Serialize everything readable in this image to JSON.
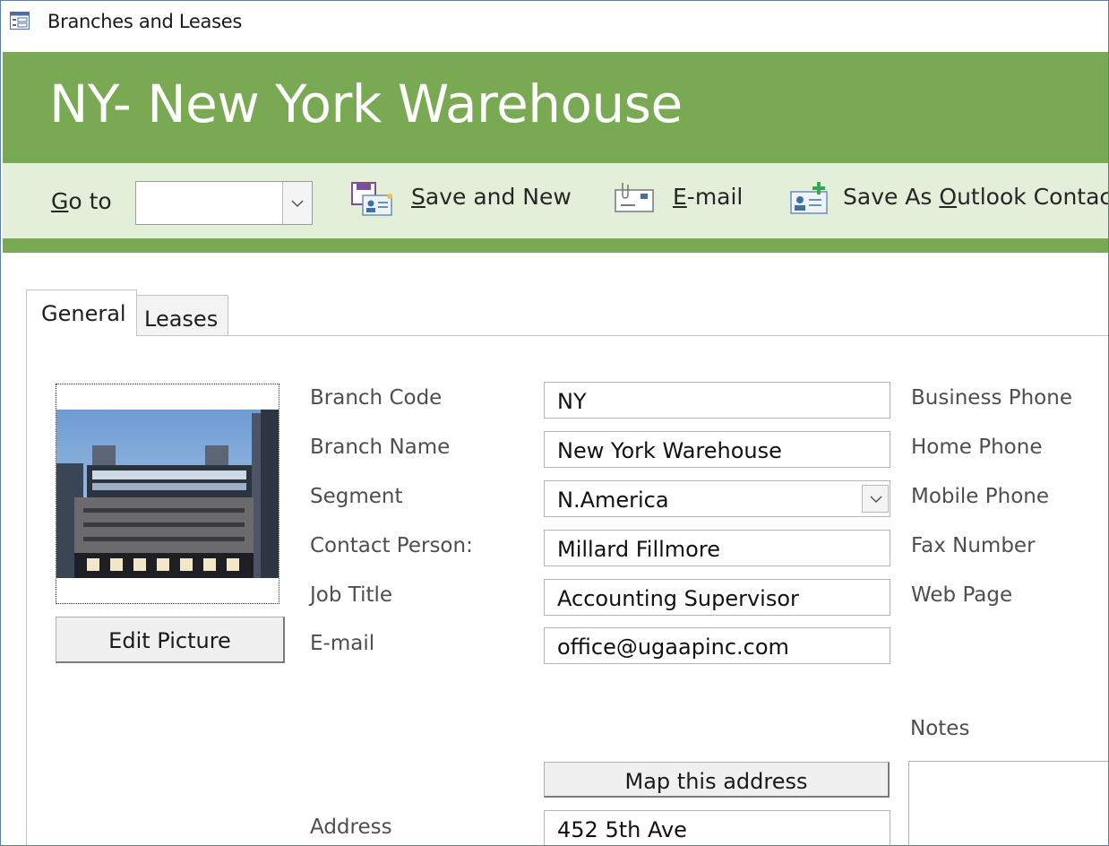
{
  "window": {
    "title": "Branches and Leases",
    "icon": "form-icon"
  },
  "header": {
    "title": "NY- New York Warehouse"
  },
  "toolbar": {
    "goto_label": "Go to",
    "goto_value": "",
    "save_new_label": "Save and New",
    "email_label": "E-mail",
    "outlook_label": "Save As Outlook Contact"
  },
  "tabs": [
    {
      "label": "General",
      "active": true
    },
    {
      "label": "Leases",
      "active": false
    }
  ],
  "picture": {
    "edit_label": "Edit Picture"
  },
  "fields": {
    "branch_code": {
      "label": "Branch Code",
      "value": "NY"
    },
    "branch_name": {
      "label": "Branch Name",
      "value": "New York Warehouse"
    },
    "segment": {
      "label": "Segment",
      "value": "N.America"
    },
    "contact_person": {
      "label": "Contact Person:",
      "value": "Millard Fillmore"
    },
    "job_title": {
      "label": "Job Title",
      "value": "Accounting Supervisor"
    },
    "email": {
      "label": "E-mail",
      "value": "office@ugaapinc.com"
    },
    "address": {
      "label": "Address",
      "value": "452 5th Ave"
    }
  },
  "phones": {
    "business": "Business Phone",
    "home": "Home Phone",
    "mobile": "Mobile Phone",
    "fax": "Fax Number",
    "web": "Web Page"
  },
  "map_button": "Map this address",
  "notes_label": "Notes",
  "colors": {
    "accent": "#7aa954",
    "toolbar_bg": "#e3efd8"
  }
}
